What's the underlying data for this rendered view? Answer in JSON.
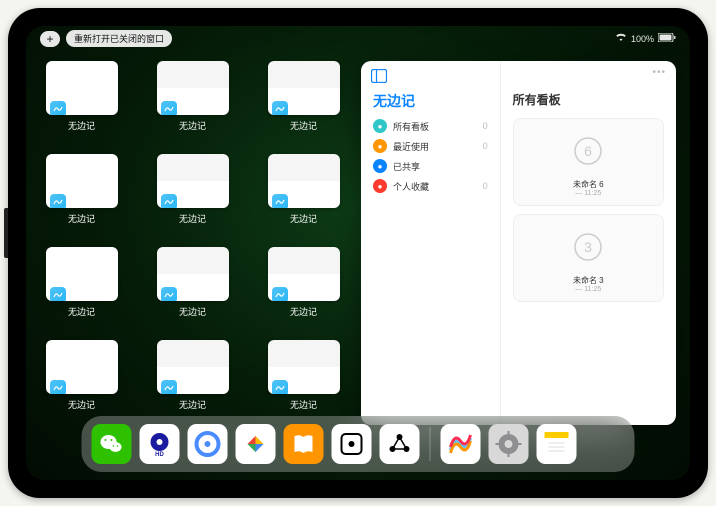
{
  "status": {
    "plus_label": "+",
    "reopen_button": "重新打开已关闭的窗口",
    "battery_text": "100%"
  },
  "thumbnails": [
    {
      "label": "无边记",
      "variant": "blank"
    },
    {
      "label": "无边记",
      "variant": "grid"
    },
    {
      "label": "无边记",
      "variant": "grid"
    },
    {
      "label": "无边记",
      "variant": "blank"
    },
    {
      "label": "无边记",
      "variant": "grid"
    },
    {
      "label": "无边记",
      "variant": "grid"
    },
    {
      "label": "无边记",
      "variant": "blank"
    },
    {
      "label": "无边记",
      "variant": "grid"
    },
    {
      "label": "无边记",
      "variant": "grid"
    },
    {
      "label": "无边记",
      "variant": "blank"
    },
    {
      "label": "无边记",
      "variant": "grid"
    },
    {
      "label": "无边记",
      "variant": "grid"
    }
  ],
  "panel": {
    "left_title": "无边记",
    "rows": [
      {
        "label": "所有看板",
        "count": "0",
        "color": "#2ec7c7"
      },
      {
        "label": "最近使用",
        "count": "0",
        "color": "#ff9500"
      },
      {
        "label": "已共享",
        "count": "",
        "color": "#0a84ff"
      },
      {
        "label": "个人收藏",
        "count": "0",
        "color": "#ff3b30"
      }
    ],
    "right_title": "所有看板",
    "boards": [
      {
        "name": "未命名 6",
        "meta": "— 11:25",
        "glyph": "6"
      },
      {
        "name": "未命名 3",
        "meta": "— 11:25",
        "glyph": "3"
      }
    ]
  },
  "dock": [
    {
      "name": "wechat",
      "bg": "#2dc100",
      "symbol": "wechat"
    },
    {
      "name": "quark-hd",
      "bg": "#ffffff",
      "symbol": "quark-hd"
    },
    {
      "name": "quark",
      "bg": "#ffffff",
      "symbol": "quark"
    },
    {
      "name": "play",
      "bg": "#ffffff",
      "symbol": "play"
    },
    {
      "name": "books",
      "bg": "#ff9500",
      "symbol": "books"
    },
    {
      "name": "dots-app",
      "bg": "#ffffff",
      "symbol": "dots"
    },
    {
      "name": "hub",
      "bg": "#ffffff",
      "symbol": "hub"
    }
  ],
  "dock_recent": [
    {
      "name": "freeform",
      "bg": "#ffffff",
      "symbol": "freeform"
    },
    {
      "name": "settings",
      "bg": "#d8d8d8",
      "symbol": "gear"
    },
    {
      "name": "notes",
      "bg": "#ffffff",
      "symbol": "notes"
    },
    {
      "name": "app-library",
      "bg": "transparent",
      "symbol": "library"
    }
  ]
}
